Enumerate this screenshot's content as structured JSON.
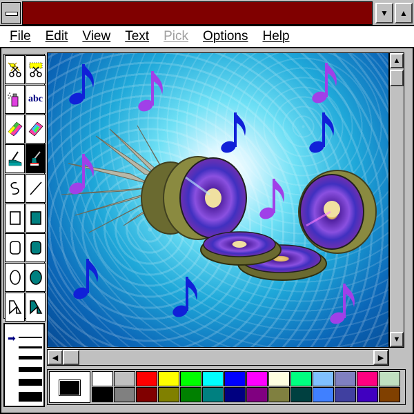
{
  "title_bar": {
    "title": "",
    "min_glyph": "▼",
    "max_glyph": "▲"
  },
  "menu": [
    {
      "label": "File",
      "enabled": true
    },
    {
      "label": "Edit",
      "enabled": true
    },
    {
      "label": "View",
      "enabled": true
    },
    {
      "label": "Text",
      "enabled": true
    },
    {
      "label": "Pick",
      "enabled": false
    },
    {
      "label": "Options",
      "enabled": true
    },
    {
      "label": "Help",
      "enabled": true
    }
  ],
  "toolbox": {
    "tools": [
      "scissors-icon",
      "pick-scissors-icon",
      "airbrush-icon",
      "text-icon",
      "color-eraser-icon",
      "eraser-icon",
      "paint-roller-icon",
      "brush-icon",
      "curve-icon",
      "line-icon",
      "rectangle-icon",
      "filled-rectangle-icon",
      "rounded-rectangle-icon",
      "filled-rounded-rectangle-icon",
      "ellipse-icon",
      "filled-ellipse-icon",
      "polygon-icon",
      "filled-polygon-icon"
    ],
    "selected": "brush-icon",
    "text_tool_label": "abc"
  },
  "line_widths": {
    "pointer_glyph": "➡",
    "selected_index": 0
  },
  "scrollbars": {
    "up": "▲",
    "down": "▼",
    "left": "◀",
    "right": "▶"
  },
  "colors": {
    "title_active": "#800000",
    "note_blue": "#1020d8",
    "note_purple": "#a040e8"
  },
  "palette": {
    "foreground": "#000000",
    "background": "#ffffff",
    "row1": [
      "#ffffff",
      "#c0c0c0",
      "#ff0000",
      "#ffff00",
      "#00ff00",
      "#00ffff",
      "#0000ff",
      "#ff00ff",
      "#ffffe0",
      "#00ff80",
      "#80c0ff",
      "#8080c0",
      "#ff0080",
      "#c0e0c0"
    ],
    "row2": [
      "#000000",
      "#808080",
      "#800000",
      "#808000",
      "#008000",
      "#008080",
      "#000080",
      "#800080",
      "#808040",
      "#004040",
      "#4080ff",
      "#4040a0",
      "#4000c0",
      "#804000"
    ]
  }
}
